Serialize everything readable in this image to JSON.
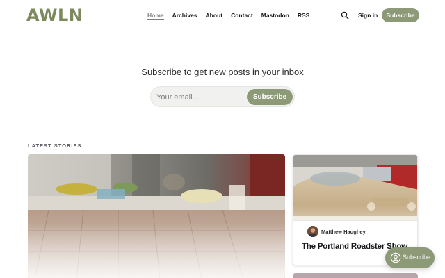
{
  "site": {
    "logo": "AWLN",
    "brand_color": "#8c9a78"
  },
  "nav": {
    "items": [
      {
        "label": "Home",
        "active": true
      },
      {
        "label": "Archives"
      },
      {
        "label": "About"
      },
      {
        "label": "Contact"
      },
      {
        "label": "Mastodon"
      },
      {
        "label": "RSS"
      }
    ],
    "search_icon": "search-icon",
    "signin_label": "Sign in",
    "subscribe_label": "Subscribe"
  },
  "cta": {
    "title": "Subscribe to get new posts in your inbox",
    "email_placeholder": "Your email...",
    "button_label": "Subscribe"
  },
  "latest": {
    "section_label": "LATEST STORIES",
    "side_story": {
      "author": "Matthew Haughey",
      "title": "The Portland Roadster Show"
    }
  },
  "portal": {
    "label": "Subscribe",
    "icon": "subscribe-icon"
  }
}
